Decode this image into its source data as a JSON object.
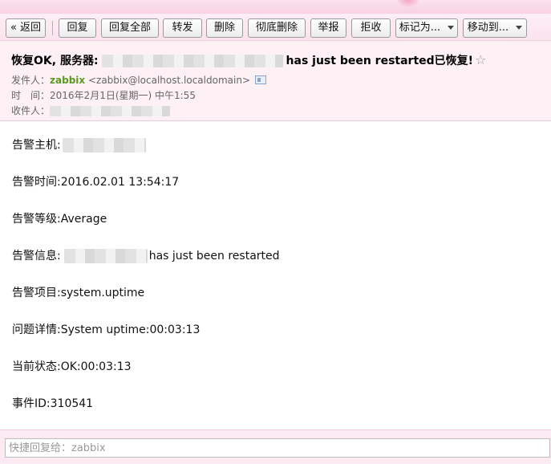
{
  "toolbar": {
    "back_label": "« 返回",
    "reply_label": "回复",
    "reply_all_label": "回复全部",
    "forward_label": "转发",
    "delete_label": "删除",
    "delete_permanent_label": "彻底删除",
    "report_label": "举报",
    "reject_label": "拒收",
    "mark_as_label": "标记为...",
    "move_to_label": "移动到..."
  },
  "header": {
    "subject_prefix": "恢复OK, 服务器:",
    "subject_suffix": "has just been restarted已恢复!",
    "star_glyph": "☆",
    "from_label": "发件人：",
    "from_name": "zabbix",
    "from_email": "<zabbix@localhost.localdomain>",
    "time_label": "时　间：",
    "time_value": "2016年2月1日(星期一) 中午1:55",
    "to_label": "收件人："
  },
  "body": {
    "host_label": "告警主机:",
    "time_line": "告警时间:2016.02.01 13:54:17",
    "severity_line": "告警等级:Average",
    "info_label": "告警信息:",
    "info_suffix": "has just been restarted",
    "item_line": "告警项目:system.uptime",
    "detail_line": "问题详情:System uptime:00:03:13",
    "status_line": "当前状态:OK:00:03:13",
    "event_line": "事件ID:310541"
  },
  "reply": {
    "placeholder": "快捷回复给：zabbix"
  }
}
